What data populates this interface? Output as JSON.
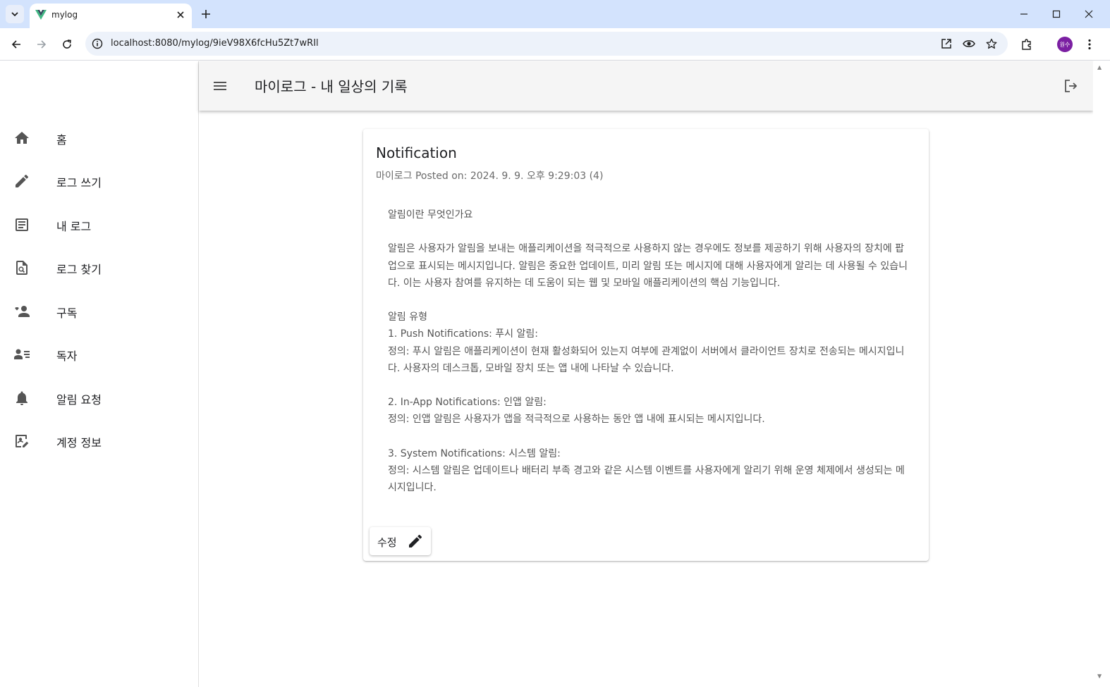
{
  "browser": {
    "tab_title": "mylog",
    "url": "localhost:8080/mylog/9ieV98X6fcHu5Zt7wRIl",
    "profile_label": "원수"
  },
  "appbar": {
    "title": "마이로그 - 내 일상의 기록"
  },
  "sidebar": {
    "items": [
      {
        "label": "홈",
        "icon": "home-icon"
      },
      {
        "label": "로그 쓰기",
        "icon": "pencil-icon"
      },
      {
        "label": "내 로그",
        "icon": "article-icon"
      },
      {
        "label": "로그 찾기",
        "icon": "find-document-icon"
      },
      {
        "label": "구독",
        "icon": "people-icon"
      },
      {
        "label": "독자",
        "icon": "readers-list-icon"
      },
      {
        "label": "알림 요청",
        "icon": "bell-icon"
      },
      {
        "label": "계정 정보",
        "icon": "account-edit-icon"
      }
    ]
  },
  "post": {
    "title": "Notification",
    "meta": "마이로그 Posted on: 2024. 9. 9. 오후 9:29:03 (4)",
    "body": "알림이란 무엇인가요\n\n알림은 사용자가 알림을 보내는 애플리케이션을 적극적으로 사용하지 않는 경우에도 정보를 제공하기 위해 사용자의 장치에 팝업으로 표시되는 메시지입니다. 알림은 중요한 업데이트, 미리 알림 또는 메시지에 대해 사용자에게 알리는 데 사용될 수 있습니다. 이는 사용자 참여를 유지하는 데 도움이 되는 웹 및 모바일 애플리케이션의 핵심 기능입니다.\n\n알림 유형\n1. Push Notifications: 푸시 알림:\n정의: 푸시 알림은 애플리케이션이 현재 활성화되어 있는지 여부에 관계없이 서버에서 클라이언트 장치로 전송되는 메시지입니다. 사용자의 데스크톱, 모바일 장치 또는 앱 내에 나타날 수 있습니다.\n\n2. In-App Notifications: 인앱 알림:\n정의: 인앱 알림은 사용자가 앱을 적극적으로 사용하는 동안 앱 내에 표시되는 메시지입니다.\n\n3. System Notifications: 시스템 알림:\n정의: 시스템 알림은 업데이트나 배터리 부족 경고와 같은 시스템 이벤트를 사용자에게 알리기 위해 운영 체제에서 생성되는 메시지입니다.",
    "edit_label": "수정"
  }
}
